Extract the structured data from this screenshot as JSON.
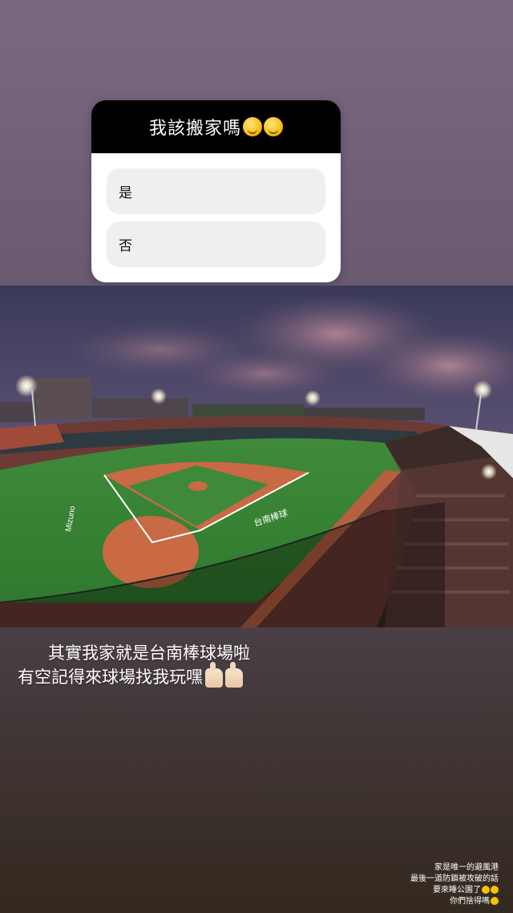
{
  "poll": {
    "question": "我該搬家嗎",
    "options": [
      {
        "label": "是"
      },
      {
        "label": "否"
      }
    ]
  },
  "caption": {
    "line1": "其實我家就是台南棒球場啦",
    "line2": "有空記得來球場找我玩嘿"
  },
  "note": {
    "line1": "家是唯一的避風港",
    "line2": "最後一道防鎖被攻破的話",
    "line3": "要來睡公園了",
    "line4": "你們捨得嗎"
  },
  "photo": {
    "field_text_1": "Mizuno",
    "field_text_2": "台南棒球"
  },
  "colors": {
    "poll_header_bg": "#000000",
    "poll_option_bg": "#efefef",
    "background_top": "#7a687f",
    "background_bottom": "#33291f"
  }
}
